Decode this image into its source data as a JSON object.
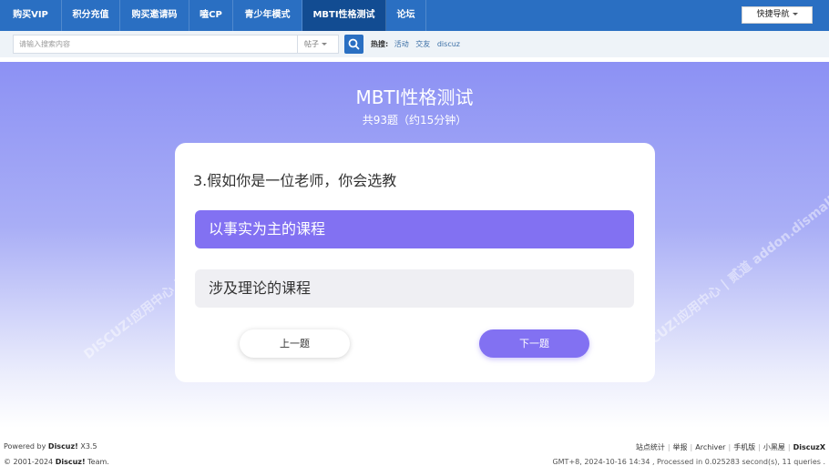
{
  "nav": {
    "items": [
      {
        "label": "购买VIP"
      },
      {
        "label": "积分充值"
      },
      {
        "label": "购买邀请码"
      },
      {
        "label": "嗑CP"
      },
      {
        "label": "青少年模式"
      },
      {
        "label": "MBTI性格测试",
        "active": true
      },
      {
        "label": "论坛"
      }
    ],
    "quick_nav": "快捷导航"
  },
  "search": {
    "placeholder": "请输入搜索内容",
    "type_selected": "帖子",
    "hot_label": "热搜:",
    "hot_links": [
      "活动",
      "交友",
      "discuz"
    ]
  },
  "quiz": {
    "title": "MBTI性格测试",
    "subtitle": "共93题（约15分钟）",
    "question": "3.假如你是一位老师，你会选教",
    "options": [
      {
        "label": "以事实为主的课程",
        "selected": true
      },
      {
        "label": "涉及理论的课程",
        "selected": false
      }
    ],
    "prev_label": "上一题",
    "next_label": "下一题",
    "watermark": "DISCUZ!应用中心 | 贰道 addon.dismall.com"
  },
  "footer": {
    "powered_prefix": "Powered by",
    "powered_brand": "Discuz!",
    "powered_version": "X3.5",
    "copyright_prefix": "© 2001-2024",
    "copyright_brand": "Discuz!",
    "copyright_suffix": "Team.",
    "links": [
      "站点统计",
      "举报",
      "Archiver",
      "手机版",
      "小黑屋",
      "DiscuzX"
    ],
    "status": "GMT+8, 2024-10-16 14:34 , Processed in 0.025283 second(s), 11 queries ."
  },
  "colors": {
    "nav_bg": "#2a6fc2",
    "nav_active": "#124c92",
    "accent": "#8271f2",
    "gradient_top": "#8c91f4"
  }
}
